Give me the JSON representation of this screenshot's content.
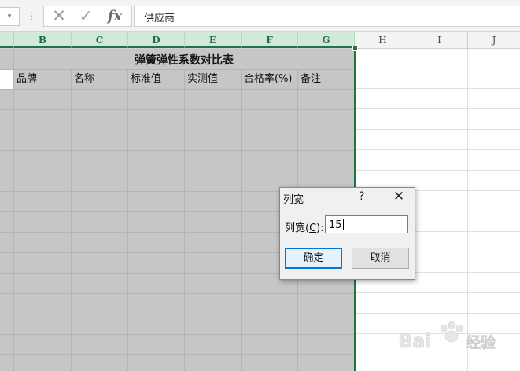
{
  "formula_bar": {
    "name_box_chevron": "▾",
    "separator": "⋮",
    "cancel_glyph": "✕",
    "confirm_glyph": "✓",
    "fx_label": "fx",
    "content": "供应商"
  },
  "columns": [
    "B",
    "C",
    "D",
    "E",
    "F",
    "G",
    "H",
    "I",
    "J"
  ],
  "sheet": {
    "title": "弹簧弹性系数对比表",
    "headers": [
      "品牌",
      "名称",
      "标准值",
      "实测值",
      "合格率(%)",
      "备注"
    ]
  },
  "dialog": {
    "title": "列宽",
    "help": "?",
    "close": "✕",
    "label_prefix": "列宽(",
    "label_hotkey": "C",
    "label_suffix": "):",
    "value": "15",
    "ok_label": "确定",
    "cancel_label": "取消"
  },
  "colors": {
    "selection_fill": "#c6c6c6",
    "selection_border": "#217346",
    "header_selected": "#d2e9d9",
    "gridline": "#e0e0e0"
  }
}
